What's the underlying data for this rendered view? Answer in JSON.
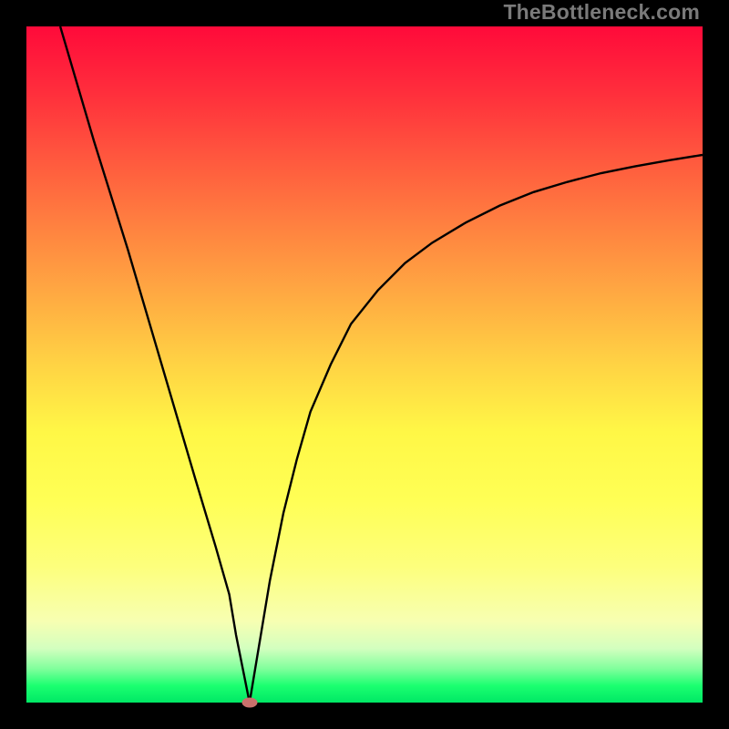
{
  "watermark": "TheBottleneck.com",
  "chart_data": {
    "type": "line",
    "title": "",
    "xlabel": "",
    "ylabel": "",
    "xlim": [
      0,
      100
    ],
    "ylim": [
      0,
      100
    ],
    "axes_visible": false,
    "background_gradient": {
      "top_color": "#ff0a3a",
      "bottom_color": "#00e865",
      "meaning": "vertical gradient from red (high/bad) at top through orange and yellow to green (low/good) at bottom"
    },
    "series": [
      {
        "name": "bottleneck-curve-left",
        "description": "steep near-linear descent from top-left to the minimum",
        "x": [
          5,
          10,
          15,
          20,
          25,
          28,
          30,
          31,
          32,
          33
        ],
        "y": [
          100,
          83,
          67,
          50,
          33,
          23,
          16,
          10,
          5,
          0
        ]
      },
      {
        "name": "bottleneck-curve-right",
        "description": "rising concave curve from minimum toward upper right, flattening",
        "x": [
          33,
          34,
          35,
          36,
          38,
          40,
          42,
          45,
          48,
          52,
          56,
          60,
          65,
          70,
          75,
          80,
          85,
          90,
          95,
          100
        ],
        "y": [
          0,
          6,
          12,
          18,
          28,
          36,
          43,
          50,
          56,
          61,
          65,
          68,
          71,
          73.5,
          75.5,
          77,
          78.3,
          79.3,
          80.2,
          81
        ]
      }
    ],
    "marker": {
      "name": "optimal-point",
      "x": 33,
      "y": 0,
      "color": "#c9716c",
      "shape": "ellipse"
    }
  }
}
